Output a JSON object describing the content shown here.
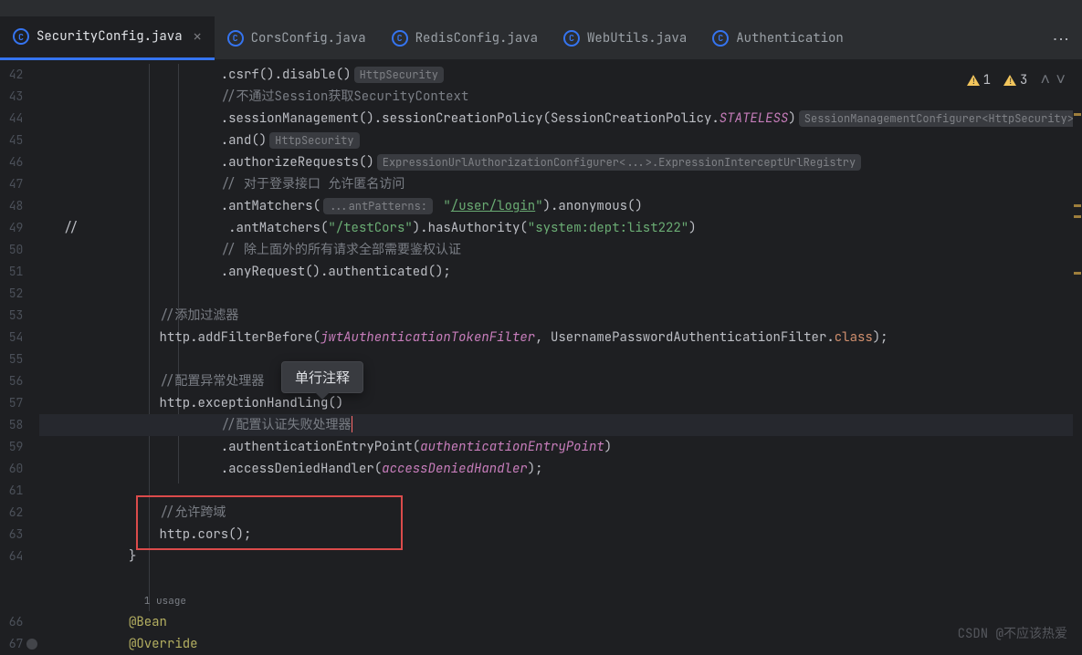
{
  "tabs": [
    {
      "label": "SecurityConfig.java",
      "active": true,
      "closable": true
    },
    {
      "label": "CorsConfig.java"
    },
    {
      "label": "RedisConfig.java"
    },
    {
      "label": "WebUtils.java"
    },
    {
      "label": "Authentication"
    }
  ],
  "inspections": {
    "weak": "1",
    "warn": "3"
  },
  "tooltip_text": "单行注释",
  "watermark": "CSDN @不应该热爱",
  "lines": [
    {
      "n": "42",
      "i": "                .",
      "seg": [
        {
          "t": "csrf",
          "c": "c-method"
        },
        {
          "t": "().",
          "c": ""
        },
        {
          "t": "disable",
          "c": "c-method"
        },
        {
          "t": "()",
          "c": ""
        },
        {
          "hint": "HttpSecurity"
        }
      ]
    },
    {
      "n": "43",
      "i": "                ",
      "seg": [
        {
          "t": "//不通过Session获取SecurityContext",
          "c": "c-comment"
        }
      ]
    },
    {
      "n": "44",
      "i": "                .",
      "seg": [
        {
          "t": "sessionManagement",
          "c": "c-method"
        },
        {
          "t": "().",
          "c": ""
        },
        {
          "t": "sessionCreationPolicy",
          "c": "c-method"
        },
        {
          "t": "(SessionCreationPolicy.",
          "c": ""
        },
        {
          "t": "STATELESS",
          "c": "c-const"
        },
        {
          "t": ")",
          "c": ""
        },
        {
          "hint": "SessionManagementConfigurer<HttpSecurity>"
        }
      ]
    },
    {
      "n": "45",
      "i": "                .",
      "seg": [
        {
          "t": "and",
          "c": "c-method"
        },
        {
          "t": "()",
          "c": ""
        },
        {
          "hint": "HttpSecurity"
        }
      ]
    },
    {
      "n": "46",
      "i": "                .",
      "seg": [
        {
          "t": "authorizeRequests",
          "c": "c-method"
        },
        {
          "t": "()",
          "c": ""
        },
        {
          "hint": "ExpressionUrlAuthorizationConfigurer<...>.ExpressionInterceptUrlRegistry"
        }
      ]
    },
    {
      "n": "47",
      "i": "                ",
      "seg": [
        {
          "t": "// 对于登录接口 允许匿名访问",
          "c": "c-comment"
        }
      ]
    },
    {
      "n": "48",
      "i": "                .",
      "seg": [
        {
          "t": "antMatchers",
          "c": "c-method"
        },
        {
          "t": "(",
          "c": ""
        },
        {
          "hint": "...antPatterns:"
        },
        {
          "t": " \"",
          "c": "c-str"
        },
        {
          "t": "/user/login",
          "c": "c-link"
        },
        {
          "t": "\"",
          "c": "c-str"
        },
        {
          "t": ").",
          "c": ""
        },
        {
          "t": "anonymous",
          "c": "c-method"
        },
        {
          "t": "()",
          "c": ""
        }
      ]
    },
    {
      "n": "49",
      "pre": "//",
      "i": "                 .",
      "seg": [
        {
          "t": "antMatchers",
          "c": "c-method"
        },
        {
          "t": "(",
          "c": ""
        },
        {
          "t": "\"/testCors\"",
          "c": "c-str"
        },
        {
          "t": ").",
          "c": ""
        },
        {
          "t": "hasAuthority",
          "c": "c-method"
        },
        {
          "t": "(",
          "c": ""
        },
        {
          "t": "\"system:dept:list222\"",
          "c": "c-str"
        },
        {
          "t": ")",
          "c": ""
        }
      ]
    },
    {
      "n": "50",
      "i": "                ",
      "seg": [
        {
          "t": "// 除上面外的所有请求全部需要鉴权认证",
          "c": "c-comment"
        }
      ]
    },
    {
      "n": "51",
      "i": "                .",
      "seg": [
        {
          "t": "anyRequest",
          "c": "c-method"
        },
        {
          "t": "().",
          "c": ""
        },
        {
          "t": "authenticated",
          "c": "c-method"
        },
        {
          "t": "();",
          "c": ""
        }
      ]
    },
    {
      "n": "52",
      "i": "",
      "seg": []
    },
    {
      "n": "53",
      "i": "        ",
      "seg": [
        {
          "t": "//添加过滤器",
          "c": "c-comment"
        }
      ]
    },
    {
      "n": "54",
      "i": "        ",
      "seg": [
        {
          "t": "http.",
          "c": ""
        },
        {
          "t": "addFilterBefore",
          "c": "c-method"
        },
        {
          "t": "(",
          "c": ""
        },
        {
          "t": "jwtAuthenticationTokenFilter",
          "c": "c-field"
        },
        {
          "t": ", UsernamePasswordAuthenticationFilter.",
          "c": ""
        },
        {
          "t": "class",
          "c": "c-kw"
        },
        {
          "t": ");",
          "c": ""
        }
      ]
    },
    {
      "n": "55",
      "i": "",
      "seg": []
    },
    {
      "n": "56",
      "i": "        ",
      "seg": [
        {
          "t": "//配置异常处理器",
          "c": "c-comment"
        }
      ]
    },
    {
      "n": "57",
      "i": "        ",
      "seg": [
        {
          "t": "http.",
          "c": ""
        },
        {
          "t": "exceptionHandling",
          "c": "c-method"
        },
        {
          "t": "()",
          "c": ""
        }
      ]
    },
    {
      "n": "58",
      "hl": true,
      "i": "                ",
      "seg": [
        {
          "t": "//配置认证失败处理器",
          "c": "c-comment"
        },
        {
          "caret": true
        }
      ]
    },
    {
      "n": "59",
      "i": "                .",
      "seg": [
        {
          "t": "authenticationEntryPoint",
          "c": "c-method"
        },
        {
          "t": "(",
          "c": ""
        },
        {
          "t": "authenticationEntryPoint",
          "c": "c-field"
        },
        {
          "t": ")",
          "c": ""
        }
      ]
    },
    {
      "n": "60",
      "i": "                .",
      "seg": [
        {
          "t": "accessDeniedHandler",
          "c": "c-method"
        },
        {
          "t": "(",
          "c": ""
        },
        {
          "t": "accessDeniedHandler",
          "c": "c-field"
        },
        {
          "t": ");",
          "c": ""
        }
      ]
    },
    {
      "n": "61",
      "i": "",
      "seg": []
    },
    {
      "n": "62",
      "i": "        ",
      "seg": [
        {
          "t": "//允许跨域",
          "c": "c-comment"
        }
      ]
    },
    {
      "n": "63",
      "i": "        ",
      "seg": [
        {
          "t": "http.",
          "c": ""
        },
        {
          "t": "cors",
          "c": "c-method"
        },
        {
          "t": "();",
          "c": ""
        }
      ]
    },
    {
      "n": "64",
      "i": "    }",
      "seg": []
    },
    {
      "n": "",
      "i": "",
      "seg": []
    },
    {
      "n": "",
      "i": "      ",
      "seg": [
        {
          "t": "1 usage",
          "c": "c-comment",
          "u": true
        }
      ]
    },
    {
      "n": "66",
      "gi": true,
      "i": "    ",
      "seg": [
        {
          "t": "@Bean",
          "c": "c-annot"
        }
      ]
    },
    {
      "n": "67",
      "i": "    ",
      "seg": [
        {
          "t": "@Override",
          "c": "c-annot"
        }
      ]
    }
  ]
}
